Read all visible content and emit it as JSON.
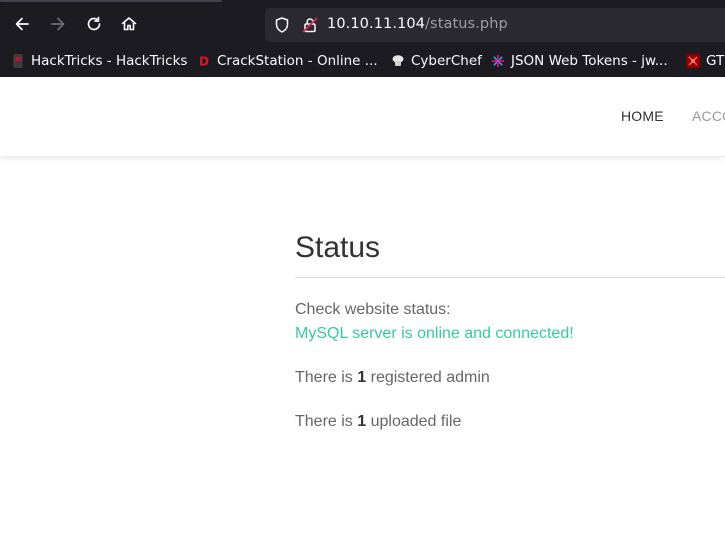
{
  "browser": {
    "url_host": "10.10.11.104",
    "url_path": "/status.php",
    "bookmarks": [
      {
        "label": "HackTricks - HackTricks",
        "icon": "hacktricks-icon"
      },
      {
        "label": "CrackStation - Online ...",
        "icon": "crackstation-icon"
      },
      {
        "label": "CyberChef",
        "icon": "cyberchef-icon"
      },
      {
        "label": "JSON Web Tokens - jw...",
        "icon": "jwt-icon"
      },
      {
        "label": "GT",
        "icon": "gtfobins-icon"
      }
    ]
  },
  "header": {
    "nav": {
      "home": "HOME",
      "accounts": "ACCO"
    }
  },
  "main": {
    "title": "Status",
    "check_label": "Check website status:",
    "db_status": "MySQL server is online and connected!",
    "admin_prefix": "There is",
    "admin_count": "1",
    "admin_suffix": "registered admin",
    "upload_prefix": "There is",
    "upload_count": "1",
    "upload_suffix": "uploaded file"
  },
  "colors": {
    "chrome_bg": "#1c1b22",
    "urlbar_bg": "#2b2a33",
    "success": "#38c9a4",
    "heading": "#333333",
    "text": "#666666"
  }
}
